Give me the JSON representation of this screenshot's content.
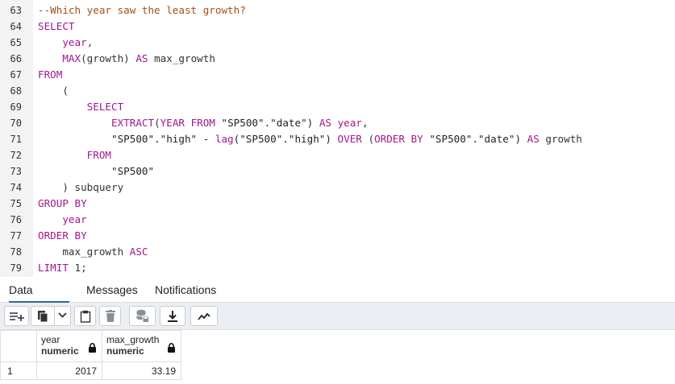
{
  "editor": {
    "lines": [
      {
        "n": "63",
        "tokens": [
          {
            "t": "--Which year saw the least growth?",
            "k": "cm"
          }
        ]
      },
      {
        "n": "64",
        "tokens": [
          {
            "t": "SELECT",
            "k": "kw"
          }
        ]
      },
      {
        "n": "65",
        "tokens": [
          {
            "t": "    ",
            "k": "pl"
          },
          {
            "t": "year",
            "k": "kw"
          },
          {
            "t": ",",
            "k": "pl"
          }
        ]
      },
      {
        "n": "66",
        "tokens": [
          {
            "t": "    ",
            "k": "pl"
          },
          {
            "t": "MAX",
            "k": "kw"
          },
          {
            "t": "(growth) ",
            "k": "pl"
          },
          {
            "t": "AS",
            "k": "kw"
          },
          {
            "t": " max_growth",
            "k": "pl"
          }
        ]
      },
      {
        "n": "67",
        "tokens": [
          {
            "t": "FROM",
            "k": "kw"
          }
        ]
      },
      {
        "n": "68",
        "tokens": [
          {
            "t": "    (",
            "k": "pl"
          }
        ]
      },
      {
        "n": "69",
        "tokens": [
          {
            "t": "        ",
            "k": "pl"
          },
          {
            "t": "SELECT",
            "k": "kw"
          }
        ]
      },
      {
        "n": "70",
        "tokens": [
          {
            "t": "            ",
            "k": "pl"
          },
          {
            "t": "EXTRACT",
            "k": "kw"
          },
          {
            "t": "(",
            "k": "pl"
          },
          {
            "t": "YEAR FROM",
            "k": "kw"
          },
          {
            "t": " \"SP500\".\"date\") ",
            "k": "str"
          },
          {
            "t": "AS",
            "k": "kw"
          },
          {
            "t": " ",
            "k": "pl"
          },
          {
            "t": "year",
            "k": "kw"
          },
          {
            "t": ",",
            "k": "pl"
          }
        ]
      },
      {
        "n": "71",
        "tokens": [
          {
            "t": "            \"SP500\".\"high\" - ",
            "k": "str"
          },
          {
            "t": "lag",
            "k": "kw"
          },
          {
            "t": "(\"SP500\".\"high\") ",
            "k": "str"
          },
          {
            "t": "OVER",
            "k": "kw"
          },
          {
            "t": " (",
            "k": "pl"
          },
          {
            "t": "ORDER BY",
            "k": "kw"
          },
          {
            "t": " \"SP500\".\"date\") ",
            "k": "str"
          },
          {
            "t": "AS",
            "k": "kw"
          },
          {
            "t": " growth",
            "k": "pl"
          }
        ]
      },
      {
        "n": "72",
        "tokens": [
          {
            "t": "        ",
            "k": "pl"
          },
          {
            "t": "FROM",
            "k": "kw"
          }
        ]
      },
      {
        "n": "73",
        "tokens": [
          {
            "t": "            \"SP500\"",
            "k": "str"
          }
        ]
      },
      {
        "n": "74",
        "tokens": [
          {
            "t": "    ) subquery",
            "k": "pl"
          }
        ]
      },
      {
        "n": "75",
        "tokens": [
          {
            "t": "GROUP BY",
            "k": "kw"
          }
        ]
      },
      {
        "n": "76",
        "tokens": [
          {
            "t": "    ",
            "k": "pl"
          },
          {
            "t": "year",
            "k": "kw"
          }
        ]
      },
      {
        "n": "77",
        "tokens": [
          {
            "t": "ORDER BY",
            "k": "kw"
          }
        ]
      },
      {
        "n": "78",
        "tokens": [
          {
            "t": "    max_growth ",
            "k": "pl"
          },
          {
            "t": "ASC",
            "k": "kw"
          }
        ]
      },
      {
        "n": "79",
        "tokens": [
          {
            "t": "LIMIT",
            "k": "kw"
          },
          {
            "t": " 1;",
            "k": "pl"
          }
        ]
      }
    ]
  },
  "tabs": [
    {
      "label": "Data Output",
      "active": true
    },
    {
      "label": "Messages",
      "active": false
    },
    {
      "label": "Notifications",
      "active": false
    }
  ],
  "toolbar": {
    "buttons": [
      {
        "icon": "add-row-icon"
      },
      {
        "icon": "copy-icon"
      },
      {
        "icon": "chevron-down-icon"
      },
      {
        "icon": "paste-icon"
      },
      {
        "icon": "delete-icon"
      },
      {
        "icon": "save-data-icon"
      },
      {
        "icon": "download-icon"
      },
      {
        "icon": "graph-icon"
      }
    ]
  },
  "grid": {
    "columns": [
      {
        "name": "year",
        "type": "numeric"
      },
      {
        "name": "max_growth",
        "type": "numeric"
      }
    ],
    "rows": [
      {
        "num": "1",
        "cells": [
          "2017",
          "33.19"
        ]
      }
    ]
  },
  "colors": {
    "keyword": "#a1178e",
    "comment": "#a0521a",
    "active_tab_underline": "#326690",
    "toolbar_bg": "#ebeef3"
  }
}
